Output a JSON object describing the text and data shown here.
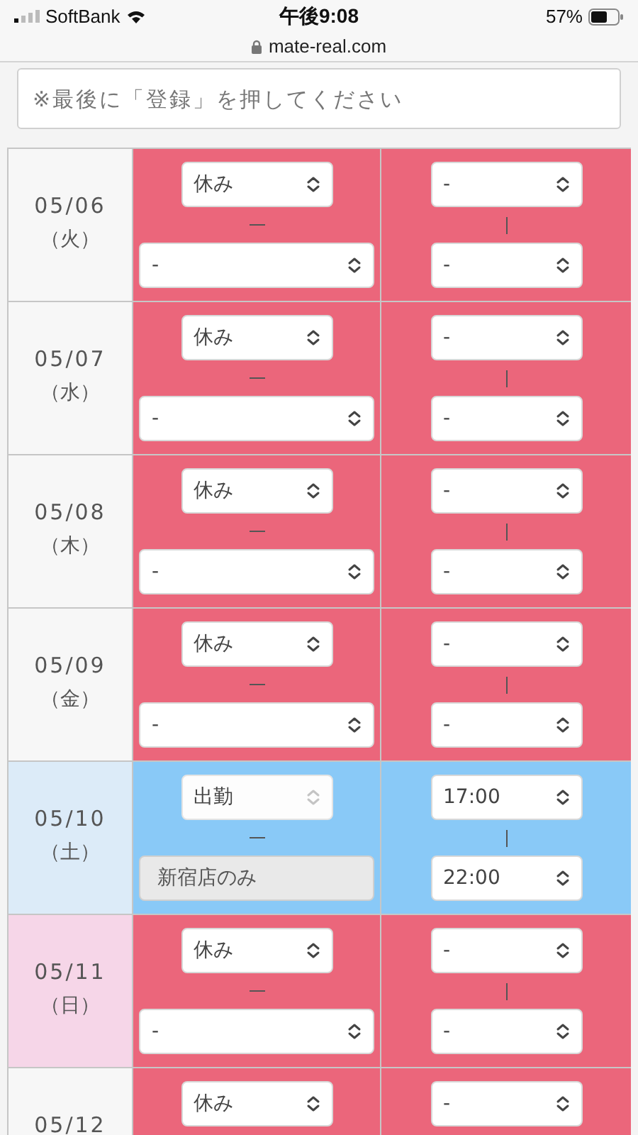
{
  "status_bar": {
    "carrier": "SoftBank",
    "time": "午後9:08",
    "battery": "57%"
  },
  "address_bar": {
    "url": "mate-real.com"
  },
  "notice": {
    "placeholder": "※最後に「登録」を押してください"
  },
  "rows": [
    {
      "date": "05/06",
      "weekday": "（火）",
      "color": "#f7f7f7",
      "kind": "off",
      "status": {
        "value": "休み",
        "disabled": false
      },
      "shop": {
        "value": "-",
        "disabled": false
      },
      "start": {
        "value": "-"
      },
      "end": {
        "value": "-"
      }
    },
    {
      "date": "05/07",
      "weekday": "（水）",
      "color": "#f7f7f7",
      "kind": "off",
      "status": {
        "value": "休み",
        "disabled": false
      },
      "shop": {
        "value": "-",
        "disabled": false
      },
      "start": {
        "value": "-"
      },
      "end": {
        "value": "-"
      }
    },
    {
      "date": "05/08",
      "weekday": "（木）",
      "color": "#f7f7f7",
      "kind": "off",
      "status": {
        "value": "休み",
        "disabled": false
      },
      "shop": {
        "value": "-",
        "disabled": false
      },
      "start": {
        "value": "-"
      },
      "end": {
        "value": "-"
      }
    },
    {
      "date": "05/09",
      "weekday": "（金）",
      "color": "#f7f7f7",
      "kind": "off",
      "status": {
        "value": "休み",
        "disabled": false
      },
      "shop": {
        "value": "-",
        "disabled": false
      },
      "start": {
        "value": "-"
      },
      "end": {
        "value": "-"
      }
    },
    {
      "date": "05/10",
      "weekday": "（土）",
      "color": "#dcebf8",
      "kind": "work",
      "status": {
        "value": "出勤",
        "disabled": true
      },
      "shop": {
        "value": "新宿店のみ",
        "disabled": true
      },
      "start": {
        "value": "17:00"
      },
      "end": {
        "value": "22:00"
      }
    },
    {
      "date": "05/11",
      "weekday": "（日）",
      "color": "#f6d6e8",
      "kind": "off",
      "status": {
        "value": "休み",
        "disabled": false
      },
      "shop": {
        "value": "-",
        "disabled": false
      },
      "start": {
        "value": "-"
      },
      "end": {
        "value": "-"
      }
    },
    {
      "date": "05/12",
      "color": "#f7f7f7",
      "kind": "off",
      "status": {
        "value": "休み",
        "disabled": false
      },
      "start": {
        "value": "-"
      }
    }
  ]
}
